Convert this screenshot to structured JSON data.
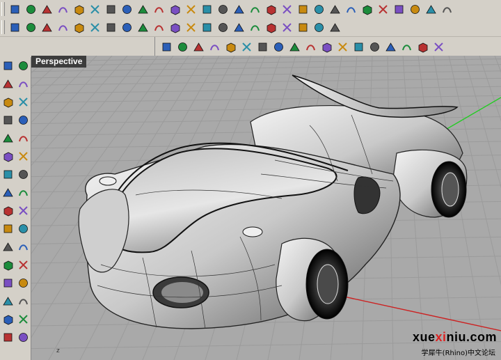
{
  "viewport": {
    "name": "Perspective",
    "axis_label": "z"
  },
  "watermark": {
    "site_a": "xue",
    "site_b": "xi",
    "site_c": "niu.com",
    "forum": "学犀牛(Rhino)中文论坛"
  },
  "toolbar1_icons": [
    "new-file-icon",
    "open-folder-icon",
    "save-icon",
    "print-icon",
    "import-icon",
    "cut-icon",
    "copy-icon",
    "paste-icon",
    "undo-icon",
    "pan-hand-icon",
    "move-arrows-icon",
    "zoom-icon",
    "zoom-window-icon",
    "zoom-extents-icon",
    "zoom-selected-icon",
    "rotate-view-icon",
    "four-views-icon",
    "car-icon",
    "grid-icon",
    "point-icon",
    "osnap-icon",
    "light-icon",
    "lock-icon",
    "shade-icon",
    "color-wheel-icon",
    "sphere-display-icon",
    "object-props-icon",
    "help-icon"
  ],
  "toolbar2_icons": [
    "surface-corner-icon",
    "extrude-icon",
    "sphere-icon",
    "box-edit-icon",
    "cylinder-icon",
    "network-icon",
    "curve-tools-icon",
    "blend-icon",
    "fillet-icon",
    "dim-icon",
    "transform-icon",
    "pipe-icon",
    "render-icon",
    "array-icon",
    "spectrum-icon",
    "color-sphere-icon",
    "material-icon",
    "layers-icon",
    "curvature-icon",
    "swatch-icon",
    "camera-icon"
  ],
  "toolbar3_icons": [
    "cylinder-a-icon",
    "cylinder-b-icon",
    "plane-icon",
    "plane-2-icon",
    "cube-icon",
    "cube-2-icon",
    "patch-icon",
    "flow-icon",
    "loft-icon",
    "rail-icon",
    "sweep-icon",
    "rebuild-icon",
    "texture-icon",
    "mesh-icon",
    "points-icon",
    "notes-icon",
    "star-icon",
    "cube-3d-icon"
  ],
  "sidebar_icons": [
    "point-icon",
    "line-icon",
    "polyline-icon",
    "arc-icon",
    "circle-icon",
    "circle-2-icon",
    "rect-icon",
    "rect-2-icon",
    "curve-icon",
    "curve-2-icon",
    "fillet-curve-icon",
    "offset-icon",
    "surface-icon",
    "surface-2-icon",
    "solid-icon",
    "solid-2-icon",
    "extrude-icon",
    "boolean-icon",
    "mesh-icon",
    "explode-icon",
    "move-icon",
    "copy-icon",
    "rotate-icon",
    "scale-icon",
    "mirror-icon",
    "array-icon",
    "bend-icon",
    "twist-icon",
    "join-icon",
    "trim-icon",
    "analyze-icon",
    "grid-icon"
  ],
  "colors": {
    "viewport_bg": "#a9a9a9",
    "grid": "#9c9c9c",
    "x_axis": "#c22",
    "y_axis": "#2c2"
  }
}
